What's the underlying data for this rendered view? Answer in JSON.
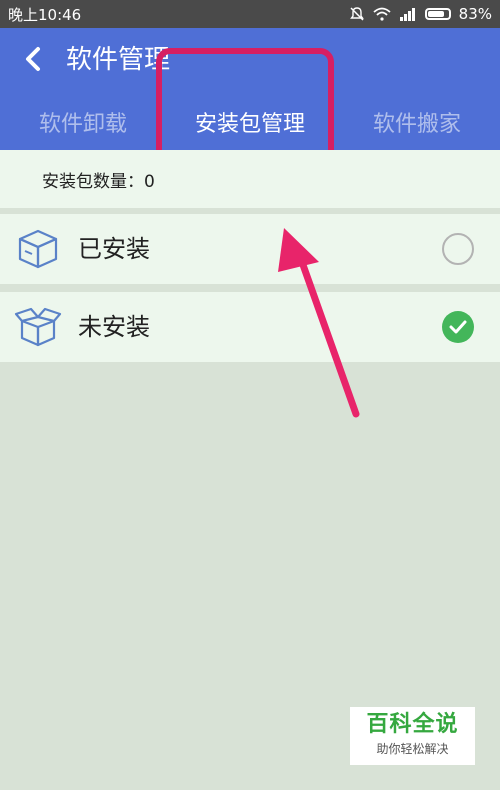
{
  "status": {
    "time": "晚上10:46",
    "battery": "83%",
    "battery_level": 0.83
  },
  "header": {
    "title": "软件管理"
  },
  "tabs": [
    {
      "label": "软件卸载",
      "active": false
    },
    {
      "label": "安装包管理",
      "active": true
    },
    {
      "label": "软件搬家",
      "active": false
    }
  ],
  "summary": {
    "count_text": "安装包数量：0"
  },
  "list": [
    {
      "label": "已安装",
      "checked": false,
      "icon": "closed-box-icon"
    },
    {
      "label": "未安装",
      "checked": true,
      "icon": "open-box-icon"
    }
  ],
  "watermark": {
    "title": "百科全说",
    "subtitle": "助你轻松解决"
  },
  "colors": {
    "primary": "#4f6fd6",
    "accent": "#d61f63",
    "check": "#43b65a",
    "row": "#edf7ed",
    "bg": "#d8e2d6"
  }
}
